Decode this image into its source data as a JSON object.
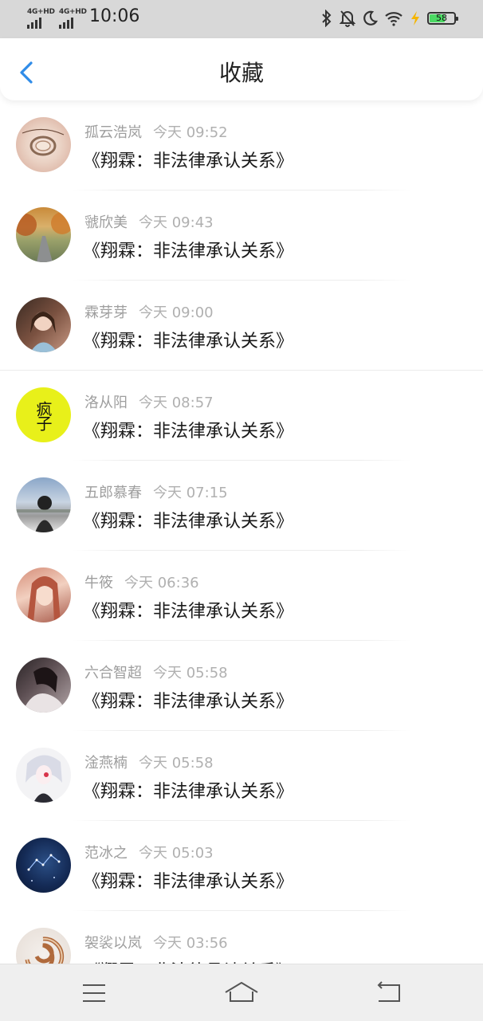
{
  "status_bar": {
    "signal1_label": "4G+HD",
    "signal2_label": "4G+HD",
    "time": "10:06",
    "battery_level": "58",
    "icons": [
      "bluetooth-icon",
      "mute-bell-icon",
      "moon-icon",
      "wifi-icon",
      "charging-icon",
      "battery-icon"
    ]
  },
  "header": {
    "title": "收藏",
    "back_icon": "chevron-left-icon",
    "accent_color": "#2f8ce8"
  },
  "favorites": [
    {
      "name": "孤云浩岚",
      "time": "今天 09:52",
      "text": "《翔霖：非法律承认关系》"
    },
    {
      "name": "虢欣美",
      "time": "今天 09:43",
      "text": "《翔霖：非法律承认关系》"
    },
    {
      "name": "霖芽芽",
      "time": "今天 09:00",
      "text": "《翔霖：非法律承认关系》"
    },
    {
      "name": "洛从阳",
      "time": "今天 08:57",
      "text": "《翔霖：非法律承认关系》",
      "avatar_text": "疯子"
    },
    {
      "name": "五郎慕春",
      "time": "今天 07:15",
      "text": "《翔霖：非法律承认关系》"
    },
    {
      "name": "牛筱",
      "time": "今天 06:36",
      "text": "《翔霖：非法律承认关系》"
    },
    {
      "name": "六合智超",
      "time": "今天 05:58",
      "text": "《翔霖：非法律承认关系》"
    },
    {
      "name": "淦燕楠",
      "time": "今天 05:58",
      "text": "《翔霖：非法律承认关系》"
    },
    {
      "name": "范冰之",
      "time": "今天 05:03",
      "text": "《翔霖：非法律承认关系》"
    },
    {
      "name": "袈裟以岚",
      "time": "今天 03:56",
      "text": "《翔霖：非法律承认关系》"
    }
  ],
  "nav_bar": {
    "icons": [
      "menu-icon",
      "home-icon",
      "back-icon"
    ]
  }
}
